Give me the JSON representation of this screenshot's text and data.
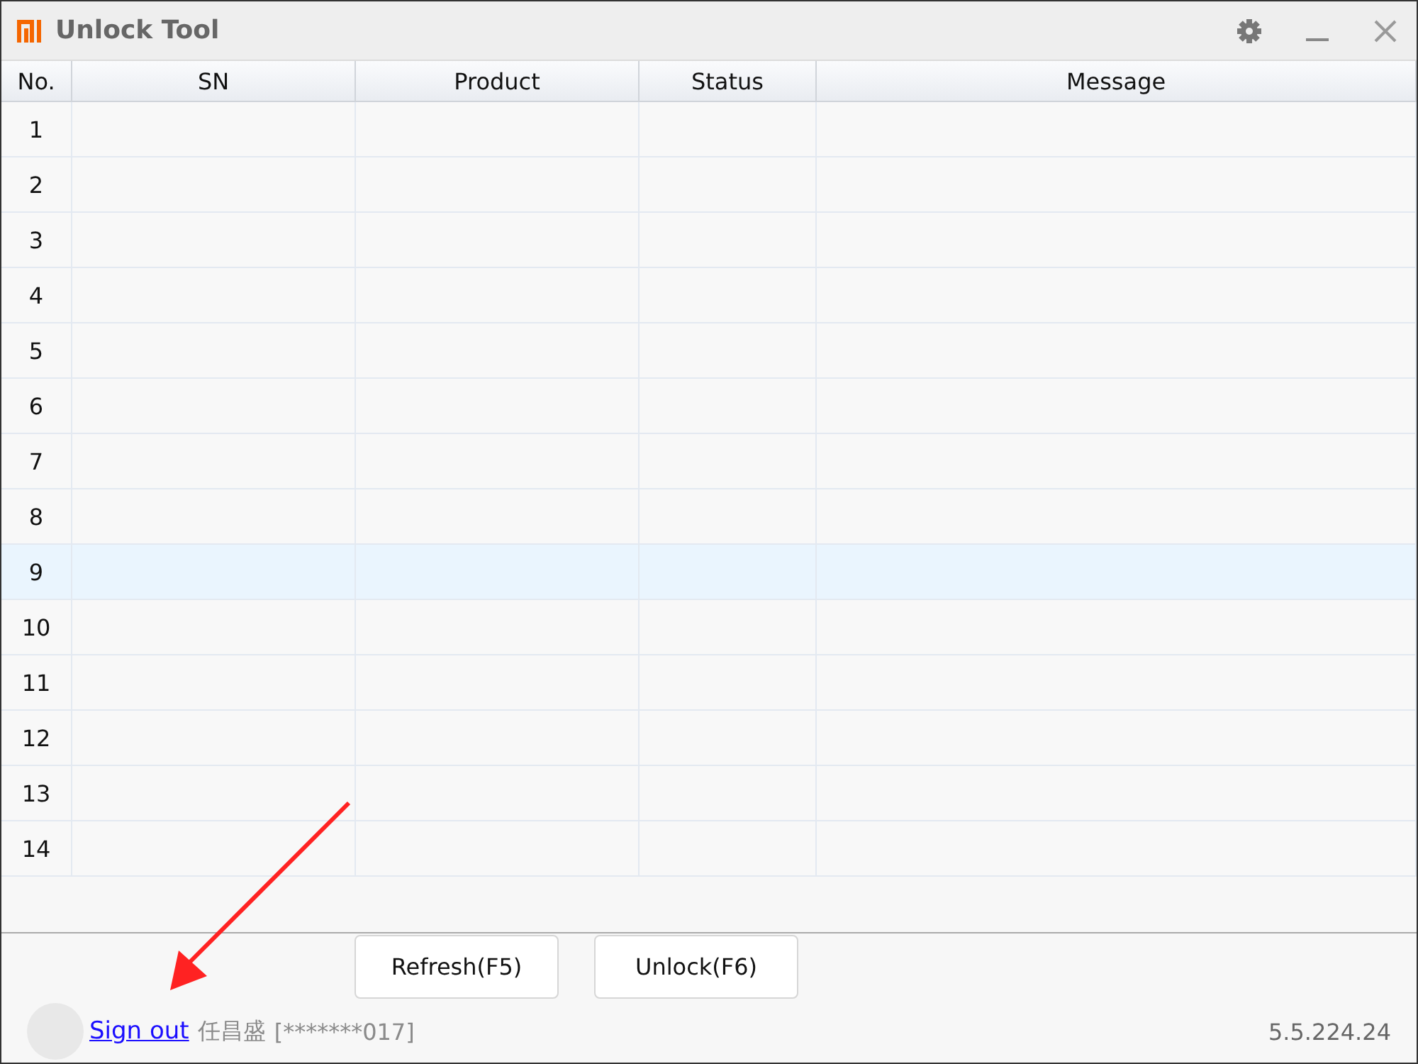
{
  "window": {
    "title": "Unlock Tool"
  },
  "table": {
    "columns": [
      "No.",
      "SN",
      "Product",
      "Status",
      "Message"
    ],
    "rows": [
      {
        "no": "1",
        "selected": false
      },
      {
        "no": "2",
        "selected": false
      },
      {
        "no": "3",
        "selected": false
      },
      {
        "no": "4",
        "selected": false
      },
      {
        "no": "5",
        "selected": false
      },
      {
        "no": "6",
        "selected": false
      },
      {
        "no": "7",
        "selected": false
      },
      {
        "no": "8",
        "selected": false
      },
      {
        "no": "9",
        "selected": true
      },
      {
        "no": "10",
        "selected": false
      },
      {
        "no": "11",
        "selected": false
      },
      {
        "no": "12",
        "selected": false
      },
      {
        "no": "13",
        "selected": false
      },
      {
        "no": "14",
        "selected": false
      }
    ]
  },
  "buttons": [
    "Refresh(F5)",
    "Unlock(F6)"
  ],
  "footer": {
    "sign_out": "Sign out",
    "user_name": "任昌盛",
    "account": "[*******017]",
    "version": "5.5.224.24"
  }
}
